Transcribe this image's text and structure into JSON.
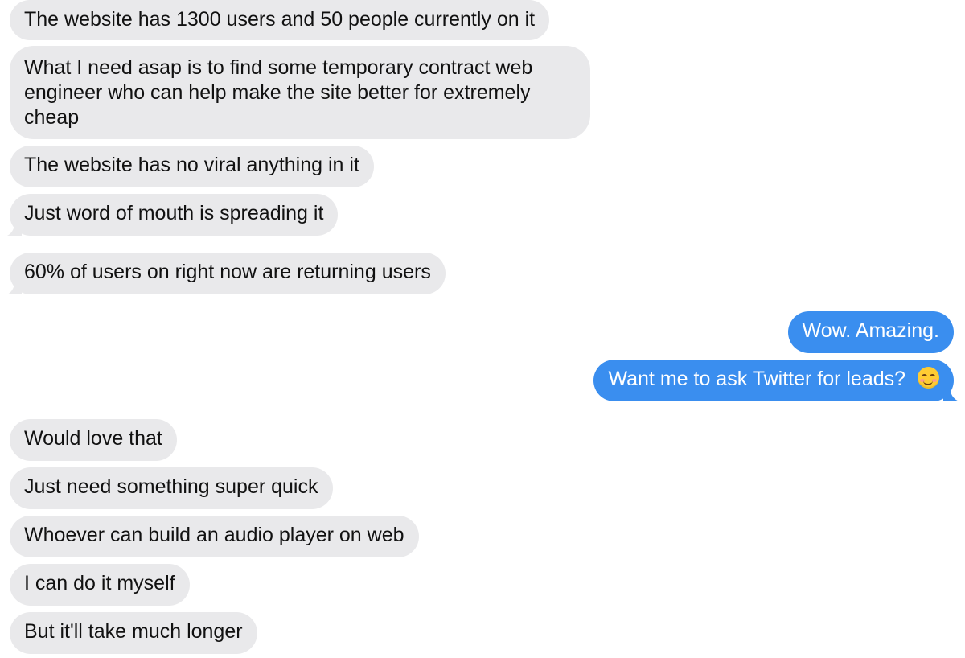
{
  "colors": {
    "incoming_bubble": "#e9e9eb",
    "incoming_text": "#111111",
    "outgoing_bubble": "#3a8eef",
    "outgoing_text": "#ffffff",
    "background": "#ffffff"
  },
  "messages": [
    {
      "direction": "incoming",
      "text": "The website has 1300 users and 50 people currently on it"
    },
    {
      "direction": "incoming",
      "text": "What I need asap is to find some temporary contract web engineer who can help make the site better for extremely cheap"
    },
    {
      "direction": "incoming",
      "text": "The website has no viral anything in it"
    },
    {
      "direction": "incoming",
      "text": "Just word of mouth is spreading it"
    },
    {
      "direction": "incoming",
      "text": "60% of users on right now are returning users"
    },
    {
      "direction": "outgoing",
      "text": "Wow. Amazing."
    },
    {
      "direction": "outgoing",
      "text": "Want me to ask Twitter for leads?",
      "emoji": "smiling-face-emoji"
    },
    {
      "direction": "incoming",
      "text": "Would love that"
    },
    {
      "direction": "incoming",
      "text": "Just need something super quick"
    },
    {
      "direction": "incoming",
      "text": "Whoever can build an audio player on web"
    },
    {
      "direction": "incoming",
      "text": "I can do it myself"
    },
    {
      "direction": "incoming",
      "text": "But it'll take much longer"
    }
  ]
}
